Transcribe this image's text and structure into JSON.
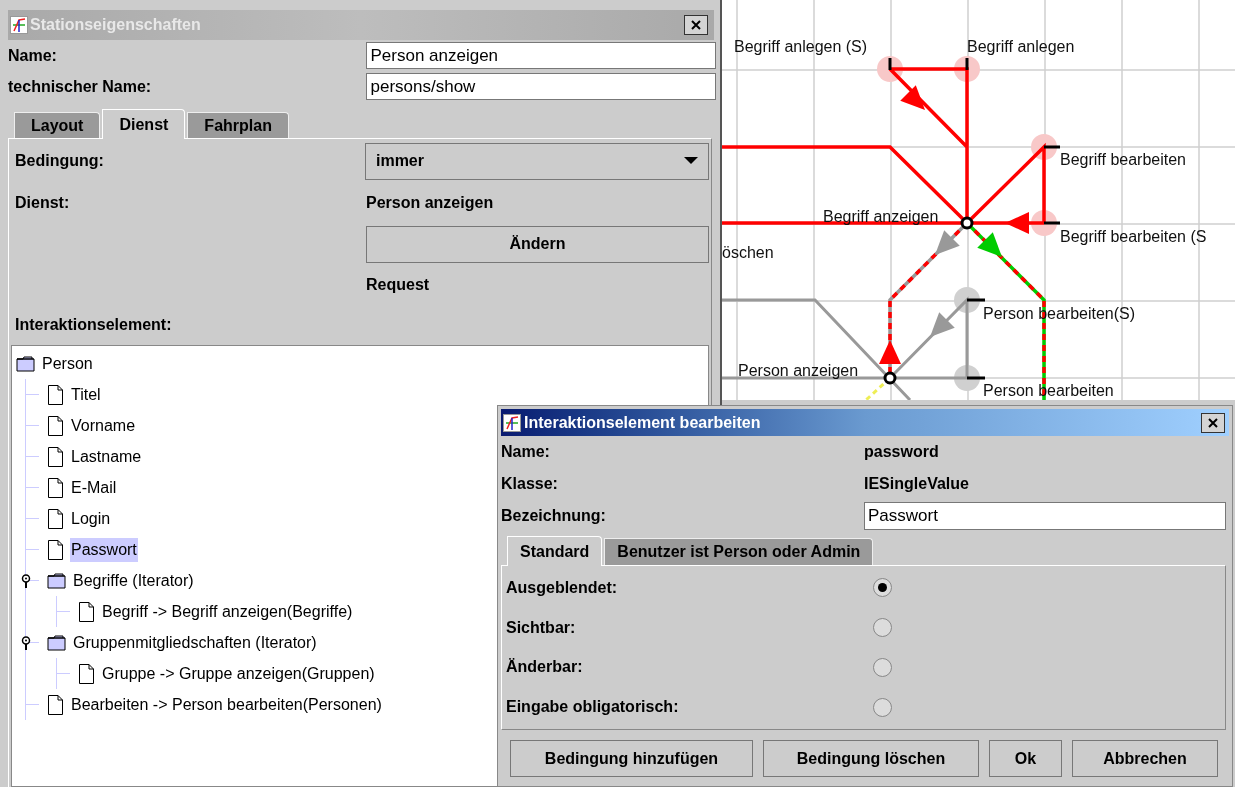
{
  "station_dialog": {
    "title": "Stationseigenschaften",
    "fields": [
      {
        "label": "Name:",
        "value": "Person anzeigen"
      },
      {
        "label": "technischer Name:",
        "value": "persons/show"
      }
    ],
    "tabs": [
      {
        "label": "Layout",
        "selected": false
      },
      {
        "label": "Dienst",
        "selected": true
      },
      {
        "label": "Fahrplan",
        "selected": false
      }
    ],
    "condition": {
      "label": "Bedingung:",
      "value": "immer"
    },
    "service": {
      "label": "Dienst:",
      "value": "Person anzeigen",
      "button": "Ändern",
      "type": "Request"
    },
    "tree_label": "Interaktionselement:",
    "tree": [
      {
        "label": "Person",
        "kind": "folder",
        "selected": false,
        "children": [
          {
            "label": "Titel",
            "kind": "file",
            "selected": false
          },
          {
            "label": "Vorname",
            "kind": "file",
            "selected": false
          },
          {
            "label": "Lastname",
            "kind": "file",
            "selected": false
          },
          {
            "label": "E-Mail",
            "kind": "file",
            "selected": false
          },
          {
            "label": "Login",
            "kind": "file",
            "selected": false
          },
          {
            "label": "Passwort",
            "kind": "file",
            "selected": true
          },
          {
            "label": "Begriffe (Iterator)",
            "kind": "folder",
            "selected": false,
            "children": [
              {
                "label": "Begriff -> Begriff anzeigen(Begriffe)",
                "kind": "file",
                "selected": false
              }
            ]
          },
          {
            "label": "Gruppenmitgliedschaften (Iterator)",
            "kind": "folder",
            "selected": false,
            "children": [
              {
                "label": "Gruppe -> Gruppe anzeigen(Gruppen)",
                "kind": "file",
                "selected": false
              }
            ]
          },
          {
            "label": "Bearbeiten -> Person bearbeiten(Personen)",
            "kind": "file",
            "selected": false
          }
        ]
      }
    ]
  },
  "route_map": {
    "stations": [
      {
        "label": "Begriff anlegen (S)"
      },
      {
        "label": "Begriff anlegen"
      },
      {
        "label": "Begriff bearbeiten"
      },
      {
        "label": "Begriff anzeigen"
      },
      {
        "label": "Begriff bearbeiten (S"
      },
      {
        "label": "öschen"
      },
      {
        "label": "Person bearbeiten(S)"
      },
      {
        "label": "Person anzeigen"
      },
      {
        "label": "Person bearbeiten"
      }
    ]
  },
  "element_dialog": {
    "title": "Interaktionselement bearbeiten",
    "info": [
      {
        "label": "Name:",
        "value": "password"
      },
      {
        "label": "Klasse:",
        "value": "IESingleValue"
      }
    ],
    "designation": {
      "label": "Bezeichnung:",
      "value": "Passwort"
    },
    "tabs": [
      {
        "label": "Standard",
        "selected": true
      },
      {
        "label": "Benutzer ist Person oder Admin",
        "selected": false
      }
    ],
    "options": [
      {
        "label": "Ausgeblendet:",
        "checked": true
      },
      {
        "label": "Sichtbar:",
        "checked": false
      },
      {
        "label": "Änderbar:",
        "checked": false
      },
      {
        "label": "Eingabe obligatorisch:",
        "checked": false
      }
    ],
    "buttons": [
      "Bedingung hinzufügen",
      "Bedingung löschen",
      "Ok",
      "Abbrechen"
    ]
  }
}
